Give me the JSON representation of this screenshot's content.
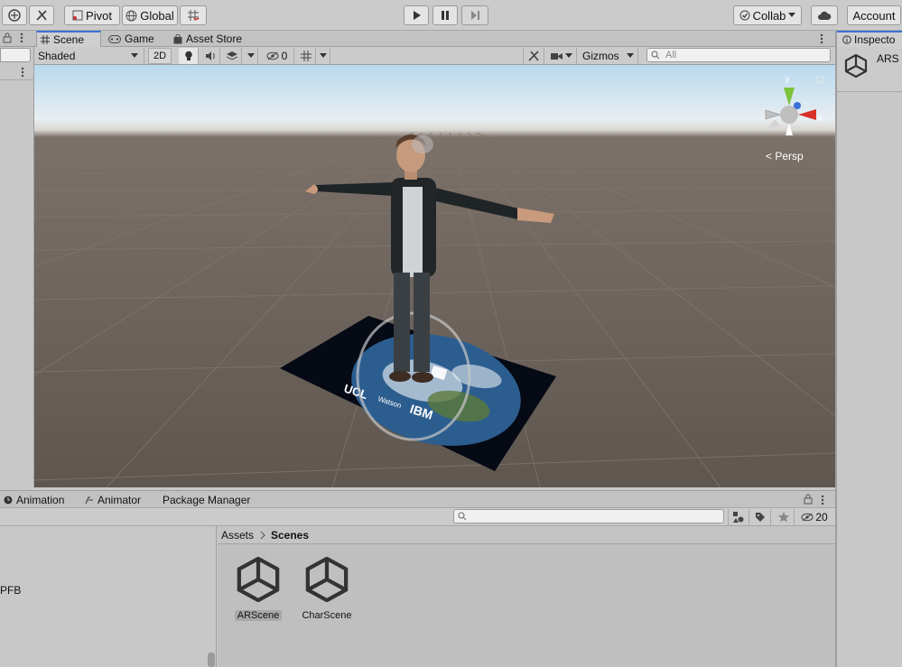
{
  "toolbar": {
    "pivot_label": "Pivot",
    "global_label": "Global",
    "collab_label": "Collab",
    "account_label": "Account"
  },
  "scene_tabs": {
    "scene": "Scene",
    "game": "Game",
    "asset_store": "Asset Store"
  },
  "scene_controls": {
    "shading_mode": "Shaded",
    "mode_2d": "2D",
    "hidden_count": "0",
    "gizmos_label": "Gizmos",
    "search_placeholder": "All"
  },
  "viewport": {
    "projection_label": "< Persp",
    "gizmo_axes": {
      "y": "y",
      "x": "x"
    },
    "marker_logos": [
      "UCL",
      "Watson",
      "IBM"
    ]
  },
  "inspector": {
    "tab_label": "Inspecto",
    "object_name": "ARS"
  },
  "bottom_tabs": {
    "animation": "Animation",
    "animator": "Animator",
    "package_manager": "Package Manager"
  },
  "project": {
    "hidden_count": "20",
    "left_item": "PFB",
    "breadcrumb": {
      "root": "Assets",
      "current": "Scenes"
    },
    "assets": [
      {
        "name": "ARScene",
        "selected": true
      },
      {
        "name": "CharScene",
        "selected": false
      }
    ]
  },
  "colors": {
    "accent": "#3a72d6",
    "gizmo_x": "#d9302a",
    "gizmo_y": "#7cc43a",
    "gizmo_z": "#3a6fd6"
  }
}
